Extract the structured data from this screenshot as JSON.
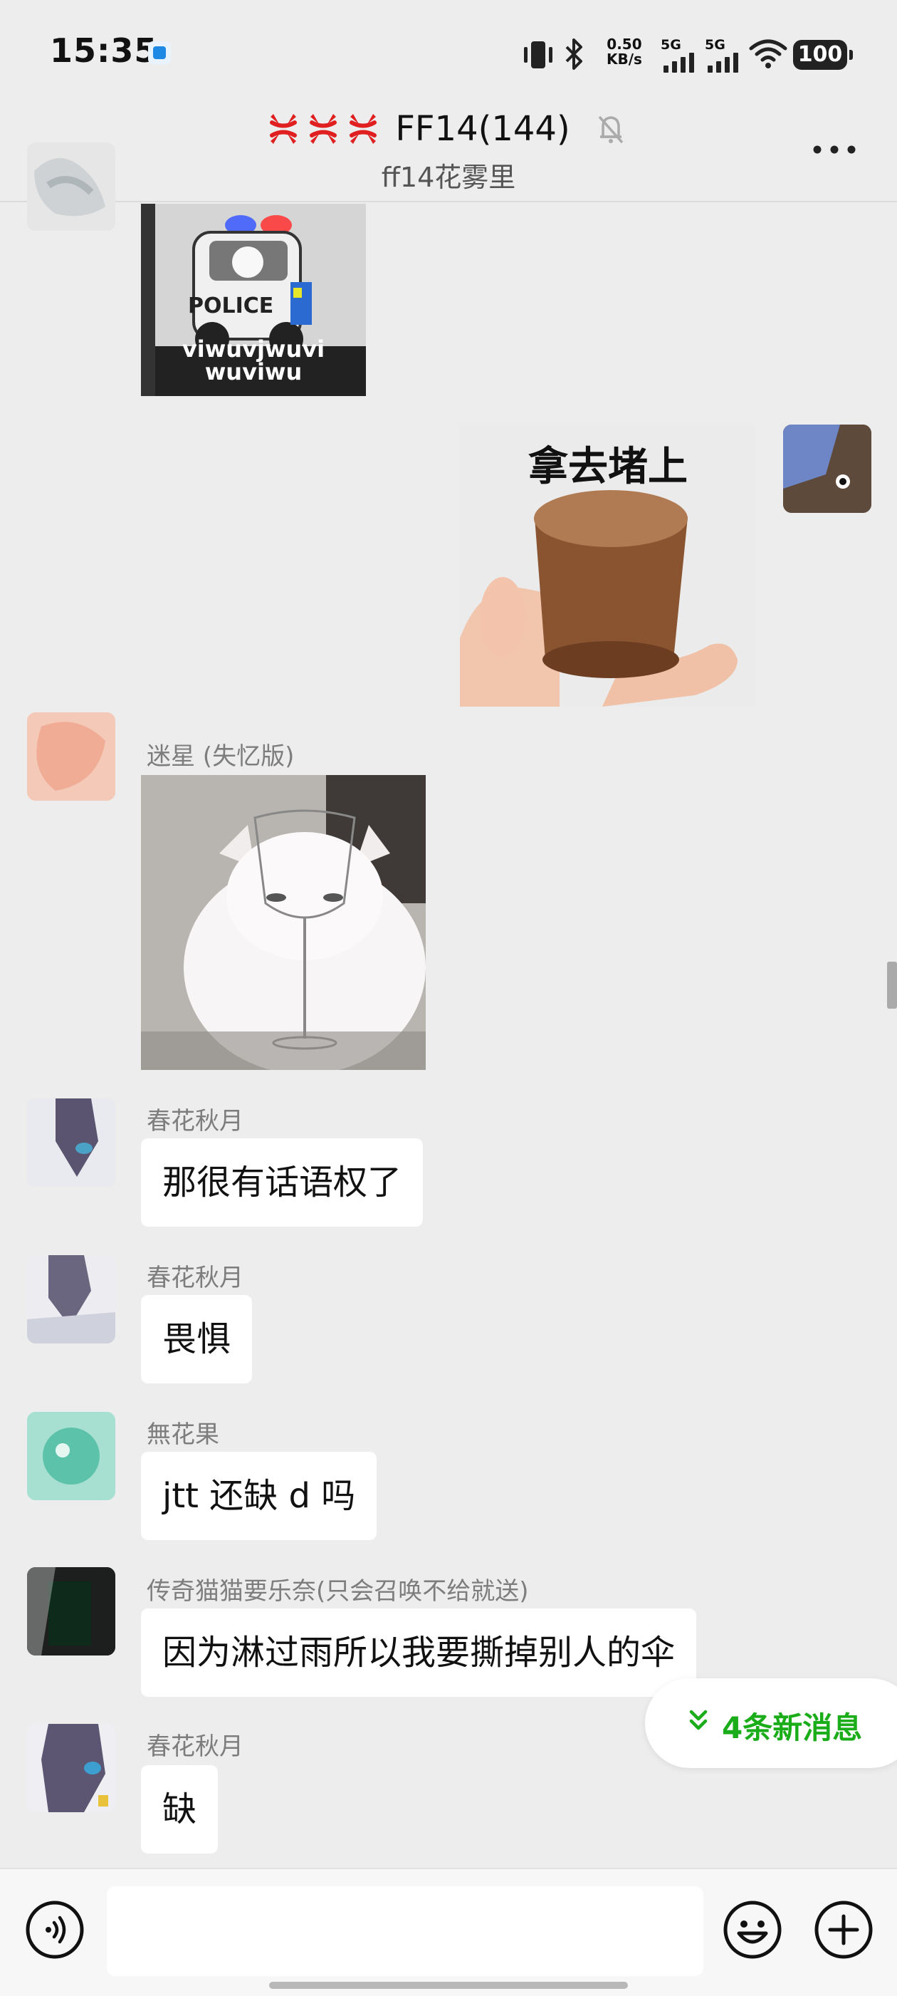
{
  "status_bar": {
    "time": "15:35",
    "net_speed_value": "0.50",
    "net_speed_unit": "KB/s",
    "signal_1_label": "5G",
    "signal_2_label": "5G",
    "battery": "100",
    "icons": [
      "vibrate-icon",
      "bluetooth-icon",
      "signal-icon",
      "wifi-icon",
      "battery-icon"
    ]
  },
  "header": {
    "title_prefix_icons": [
      "anger-icon",
      "anger-icon",
      "anger-icon"
    ],
    "title": "FF14(144)",
    "subtitle": "ff14花雾里",
    "muted_icon": "bell-muted-icon",
    "more_icon": "more-icon"
  },
  "messages": [
    {
      "type": "sticker",
      "side": "left",
      "caption_1": "POLICE",
      "caption_2": "viwuvjwuvi",
      "caption_3": "wuviwu"
    },
    {
      "type": "sticker",
      "side": "right",
      "caption": "拿去堵上"
    },
    {
      "type": "sticker",
      "side": "left",
      "sender": "迷星 (失忆版)"
    },
    {
      "type": "text",
      "side": "left",
      "sender": "春花秋月",
      "text": "那很有话语权了"
    },
    {
      "type": "text",
      "side": "left",
      "sender": "春花秋月",
      "text": "畏惧"
    },
    {
      "type": "text",
      "side": "left",
      "sender": "無花果",
      "text": "jtt 还缺 d 吗"
    },
    {
      "type": "text",
      "side": "left",
      "sender": "传奇猫猫要乐奈(只会召唤不给就送)",
      "text": "因为淋过雨所以我要撕掉别人的伞"
    },
    {
      "type": "text",
      "side": "left",
      "sender": "春花秋月",
      "text": "缺"
    }
  ],
  "new_messages_pill": {
    "label": "4条新消息",
    "icon": "double-chevron-down-icon",
    "color": "#1aad19"
  },
  "input_bar": {
    "voice_icon": "voice-icon",
    "input_value": "",
    "emoji_icon": "emoji-icon",
    "plus_icon": "plus-icon"
  },
  "colors": {
    "background": "#ededed",
    "bubble": "#ffffff",
    "accent_green": "#1aad19"
  }
}
